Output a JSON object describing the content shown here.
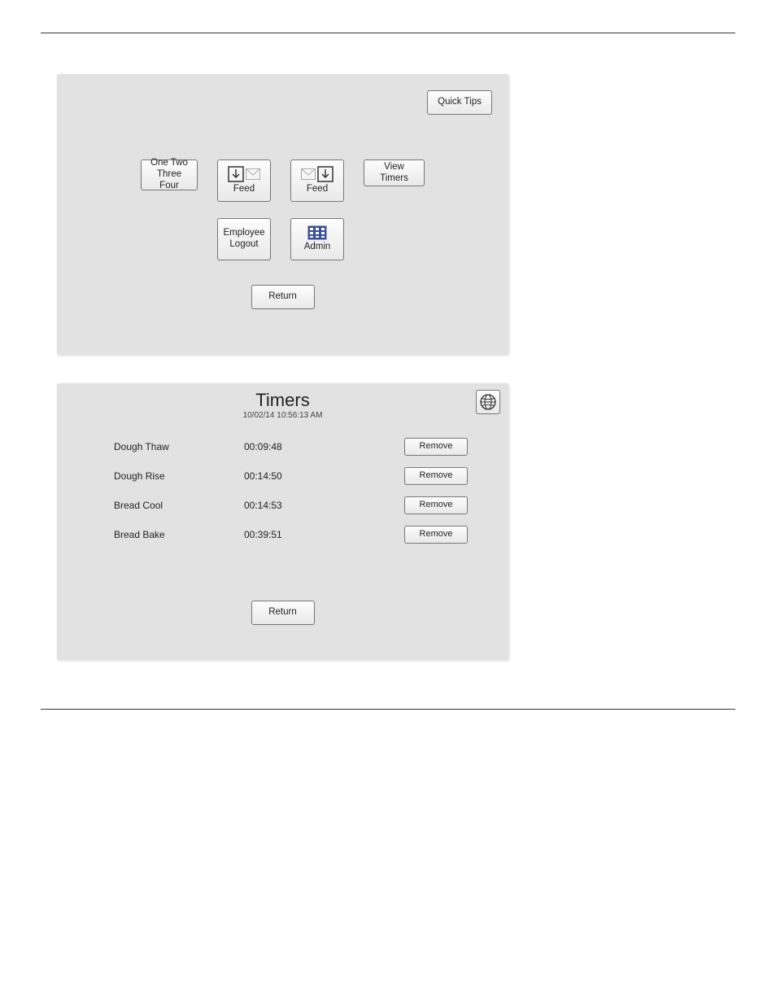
{
  "panel1": {
    "quick_tips": "Quick Tips",
    "one_two": "One Two",
    "three_four": "Three Four",
    "feed": "Feed",
    "view_timers": "View Timers",
    "employee_logout_line1": "Employee",
    "employee_logout_line2": "Logout",
    "admin": "Admin",
    "return": "Return"
  },
  "panel2": {
    "title": "Timers",
    "timestamp": "10/02/14  10:56:13 AM",
    "remove_label": "Remove",
    "return": "Return",
    "timers": [
      {
        "name": "Dough Thaw",
        "time": "00:09:48"
      },
      {
        "name": "Dough Rise",
        "time": "00:14:50"
      },
      {
        "name": "Bread Cool",
        "time": "00:14:53"
      },
      {
        "name": "Bread Bake",
        "time": "00:39:51"
      }
    ]
  }
}
